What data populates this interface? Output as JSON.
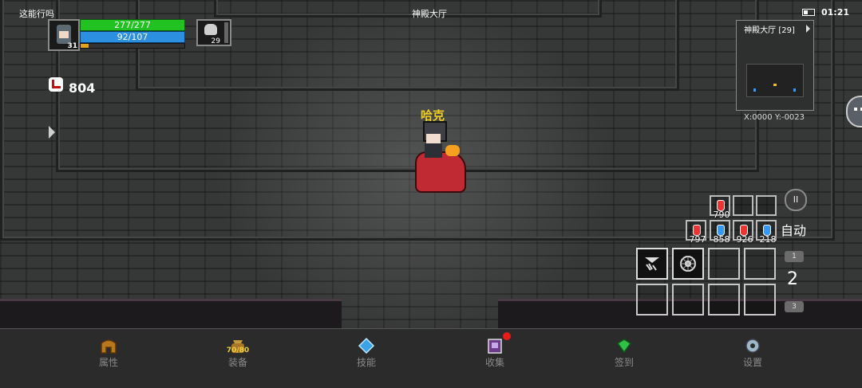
{
  "status_bar": {
    "left_text": "这能行吗",
    "location": "神殿大厅",
    "time": "01:21"
  },
  "player": {
    "level": "31",
    "hp": "277/277",
    "mp": "92/107",
    "xp_fraction": 0.08,
    "name": "哈克"
  },
  "pet": {
    "level": "29"
  },
  "timer": {
    "value": "804"
  },
  "minimap": {
    "title": "神殿大厅 [29]",
    "coords": "X:0000  Y:-0023"
  },
  "potions": {
    "top": [
      {
        "count": "790",
        "color": "red"
      },
      {
        "count": "",
        "color": ""
      },
      {
        "count": "",
        "color": ""
      }
    ],
    "bottom": [
      {
        "count": "797",
        "color": "red"
      },
      {
        "count": "858",
        "color": "blue"
      },
      {
        "count": "926",
        "color": "red"
      },
      {
        "count": "218",
        "color": "blue"
      }
    ]
  },
  "auto_label": "自动",
  "pause_symbol": "II",
  "skill_pages": {
    "up": "1",
    "current": "2",
    "down": "3"
  },
  "nav": [
    {
      "id": "attributes",
      "label": "属性",
      "icon": "helmet-icon",
      "sub": ""
    },
    {
      "id": "equipment",
      "label": "装备",
      "icon": "bag-icon",
      "sub": "70/80"
    },
    {
      "id": "skills",
      "label": "技能",
      "icon": "skill-gem-icon",
      "sub": ""
    },
    {
      "id": "collection",
      "label": "收集",
      "icon": "collection-book-icon",
      "sub": ""
    },
    {
      "id": "checkin",
      "label": "签到",
      "icon": "diamond-icon",
      "sub": ""
    },
    {
      "id": "settings",
      "label": "设置",
      "icon": "gear-icon",
      "sub": ""
    }
  ],
  "colors": {
    "hp": "#23c223",
    "mp": "#2c8fe0",
    "xp": "#e6a21a",
    "name": "#f0d020",
    "notification": "#e81b1b"
  }
}
